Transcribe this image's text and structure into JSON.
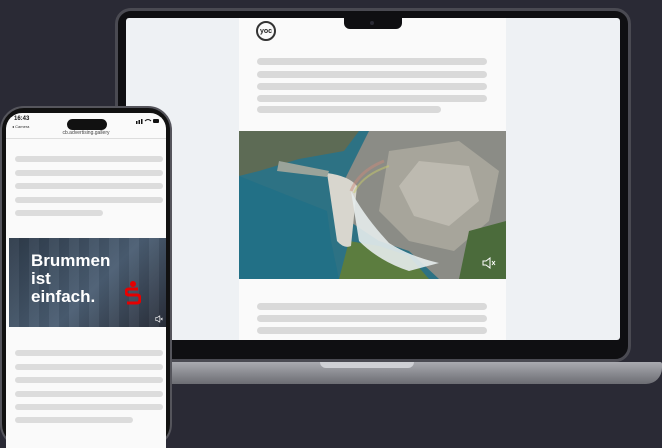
{
  "laptop": {
    "logo_text": "yoc"
  },
  "phone": {
    "time": "16:43",
    "back_label": "◂ Camera",
    "url": "cb.advertising.gallery",
    "ad_lines": [
      "Brummen",
      "ist",
      "einfach."
    ]
  },
  "colors": {
    "background": "#2a2a35",
    "ad_logo_red": "#e60000"
  }
}
